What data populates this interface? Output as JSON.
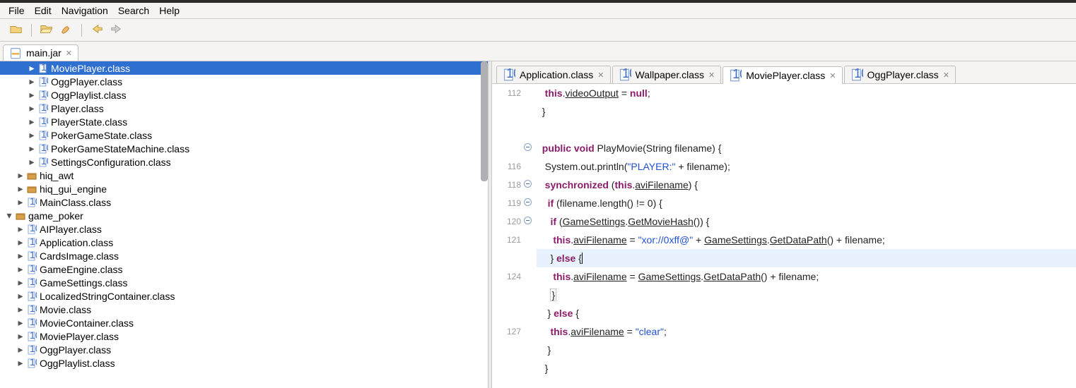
{
  "menu": {
    "items": [
      "File",
      "Edit",
      "Navigation",
      "Search",
      "Help"
    ]
  },
  "mainTab": {
    "label": "main.jar"
  },
  "tree": [
    {
      "depth": 2,
      "tw": "▸",
      "icon": "class",
      "label": "MoviePlayer.class",
      "selected": true
    },
    {
      "depth": 2,
      "tw": "▸",
      "icon": "class",
      "label": "OggPlayer.class"
    },
    {
      "depth": 2,
      "tw": "▸",
      "icon": "class",
      "label": "OggPlaylist.class"
    },
    {
      "depth": 2,
      "tw": "▸",
      "icon": "class",
      "label": "Player.class"
    },
    {
      "depth": 2,
      "tw": "▸",
      "icon": "class",
      "label": "PlayerState.class"
    },
    {
      "depth": 2,
      "tw": "▸",
      "icon": "class",
      "label": "PokerGameState.class"
    },
    {
      "depth": 2,
      "tw": "▸",
      "icon": "class",
      "label": "PokerGameStateMachine.class"
    },
    {
      "depth": 2,
      "tw": "▸",
      "icon": "class",
      "label": "SettingsConfiguration.class"
    },
    {
      "depth": 1,
      "tw": "▸",
      "icon": "pkg",
      "label": "hiq_awt"
    },
    {
      "depth": 1,
      "tw": "▸",
      "icon": "pkg",
      "label": "hiq_gui_engine"
    },
    {
      "depth": 1,
      "tw": "▸",
      "icon": "class",
      "label": "MainClass.class"
    },
    {
      "depth": 0,
      "tw": "▾",
      "icon": "pkg",
      "label": "game_poker"
    },
    {
      "depth": 1,
      "tw": "▸",
      "icon": "class",
      "label": "AIPlayer.class"
    },
    {
      "depth": 1,
      "tw": "▸",
      "icon": "class",
      "label": "Application.class"
    },
    {
      "depth": 1,
      "tw": "▸",
      "icon": "class",
      "label": "CardsImage.class"
    },
    {
      "depth": 1,
      "tw": "▸",
      "icon": "class",
      "label": "GameEngine.class"
    },
    {
      "depth": 1,
      "tw": "▸",
      "icon": "class",
      "label": "GameSettings.class"
    },
    {
      "depth": 1,
      "tw": "▸",
      "icon": "class",
      "label": "LocalizedStringContainer.class"
    },
    {
      "depth": 1,
      "tw": "▸",
      "icon": "class",
      "label": "Movie.class"
    },
    {
      "depth": 1,
      "tw": "▸",
      "icon": "class",
      "label": "MovieContainer.class"
    },
    {
      "depth": 1,
      "tw": "▸",
      "icon": "class",
      "label": "MoviePlayer.class"
    },
    {
      "depth": 1,
      "tw": "▸",
      "icon": "class",
      "label": "OggPlayer.class"
    },
    {
      "depth": 1,
      "tw": "▸",
      "icon": "class",
      "label": "OggPlaylist.class"
    }
  ],
  "editorTabs": [
    {
      "label": "Application.class",
      "active": false
    },
    {
      "label": "Wallpaper.class",
      "active": false
    },
    {
      "label": "MoviePlayer.class",
      "active": true
    },
    {
      "label": "OggPlayer.class",
      "active": false
    }
  ],
  "code": {
    "lines": [
      {
        "num": "112",
        "fold": false,
        "html": "   <span class='this'>this</span>.<span class='und'>videoOutput</span> = <span class='kw'>null</span>;"
      },
      {
        "num": "",
        "fold": false,
        "html": "  }"
      },
      {
        "num": "",
        "fold": false,
        "html": " "
      },
      {
        "num": "",
        "fold": true,
        "html": "  <span class='kw'>public void</span> PlayMovie(String filename) {"
      },
      {
        "num": "116",
        "fold": false,
        "html": "   System.out.println(<span class='str'>\"PLAYER:\"</span> + filename);"
      },
      {
        "num": "118",
        "fold": true,
        "html": "   <span class='kw'>synchronized</span> (<span class='this'>this</span>.<span class='und'>aviFilename</span>) {"
      },
      {
        "num": "119",
        "fold": true,
        "html": "    <span class='kw'>if</span> (filename.length() != 0) {"
      },
      {
        "num": "120",
        "fold": true,
        "html": "     <span class='kw'>if</span> (<span class='und'>GameSettings</span>.<span class='und'>GetMovieHash</span>()) {"
      },
      {
        "num": "121",
        "fold": false,
        "html": "      <span class='this'>this</span>.<span class='und'>aviFilename</span> = <span class='str'>\"xor://0xff@\"</span> + <span class='und'>GameSettings</span>.<span class='und'>GetDataPath</span>() + filename;"
      },
      {
        "num": "",
        "fold": false,
        "hl": true,
        "html": "     } <span class='kw'>else</span> {<span class='caret'></span>"
      },
      {
        "num": "124",
        "fold": false,
        "html": "      <span class='this'>this</span>.<span class='und'>aviFilename</span> = <span class='und'>GameSettings</span>.<span class='und'>GetDataPath</span>() + filename;"
      },
      {
        "num": "",
        "fold": false,
        "html": "     <span class='dotbox'>}</span>"
      },
      {
        "num": "",
        "fold": false,
        "html": "    } <span class='kw'>else</span> {"
      },
      {
        "num": "127",
        "fold": false,
        "html": "     <span class='this'>this</span>.<span class='und'>aviFilename</span> = <span class='str'>\"clear\"</span>;"
      },
      {
        "num": "",
        "fold": false,
        "html": "    }"
      },
      {
        "num": "",
        "fold": false,
        "html": "   }"
      }
    ]
  }
}
